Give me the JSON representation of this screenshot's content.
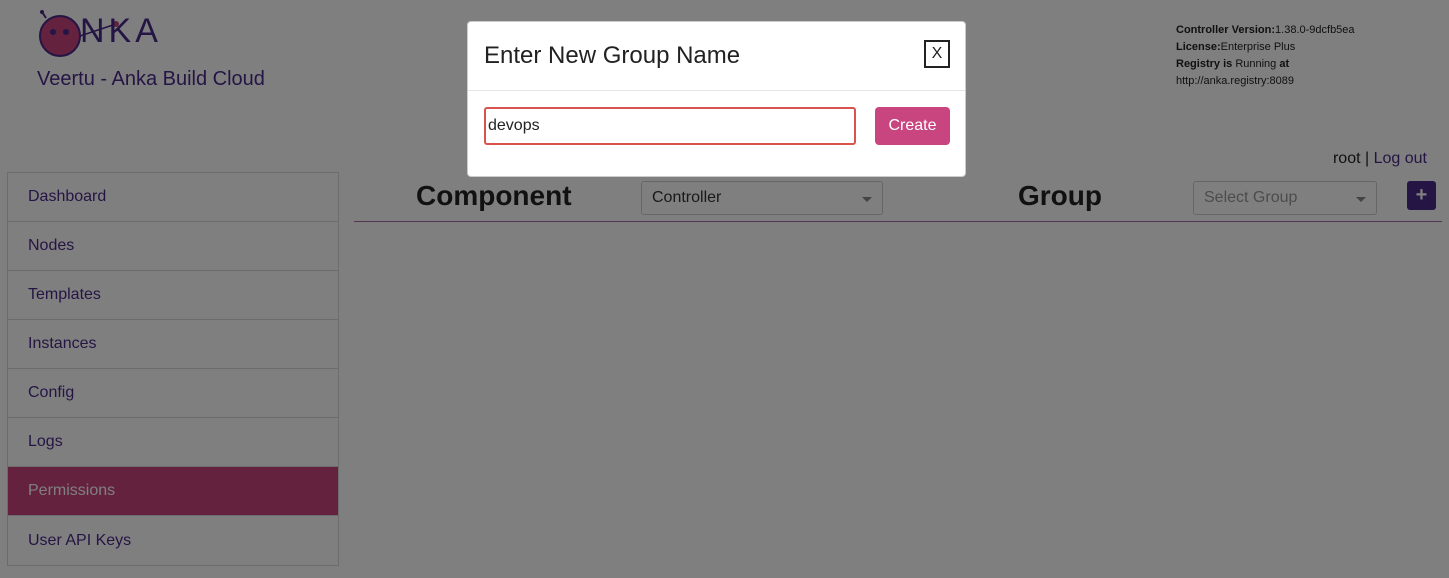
{
  "header": {
    "logo_text": "NKA",
    "brand": "Veertu - Anka Build Cloud",
    "version": {
      "controller_label": "Controller Version:",
      "controller_value": "1.38.0-9dcfb5ea",
      "license_label": "License:",
      "license_value": "Enterprise Plus",
      "registry_label": "Registry is",
      "registry_status": "Running",
      "registry_at": "at",
      "registry_url": "http://anka.registry:8089"
    },
    "user": "root",
    "separator": "|",
    "logout": "Log out"
  },
  "sidebar": {
    "items": [
      {
        "label": "Dashboard"
      },
      {
        "label": "Nodes"
      },
      {
        "label": "Templates"
      },
      {
        "label": "Instances"
      },
      {
        "label": "Config"
      },
      {
        "label": "Logs"
      },
      {
        "label": "Permissions"
      },
      {
        "label": "User API Keys"
      }
    ],
    "active": "Permissions"
  },
  "toolbar": {
    "component_label": "Component",
    "component_value": "Controller",
    "group_label": "Group",
    "group_placeholder": "Select Group",
    "add_label": "+"
  },
  "modal": {
    "title": "Enter New Group Name",
    "close_label": "X",
    "input_value": "devops",
    "create_label": "Create"
  },
  "colors": {
    "brand_purple": "#4b2a8a",
    "accent_pink": "#c8457f"
  }
}
